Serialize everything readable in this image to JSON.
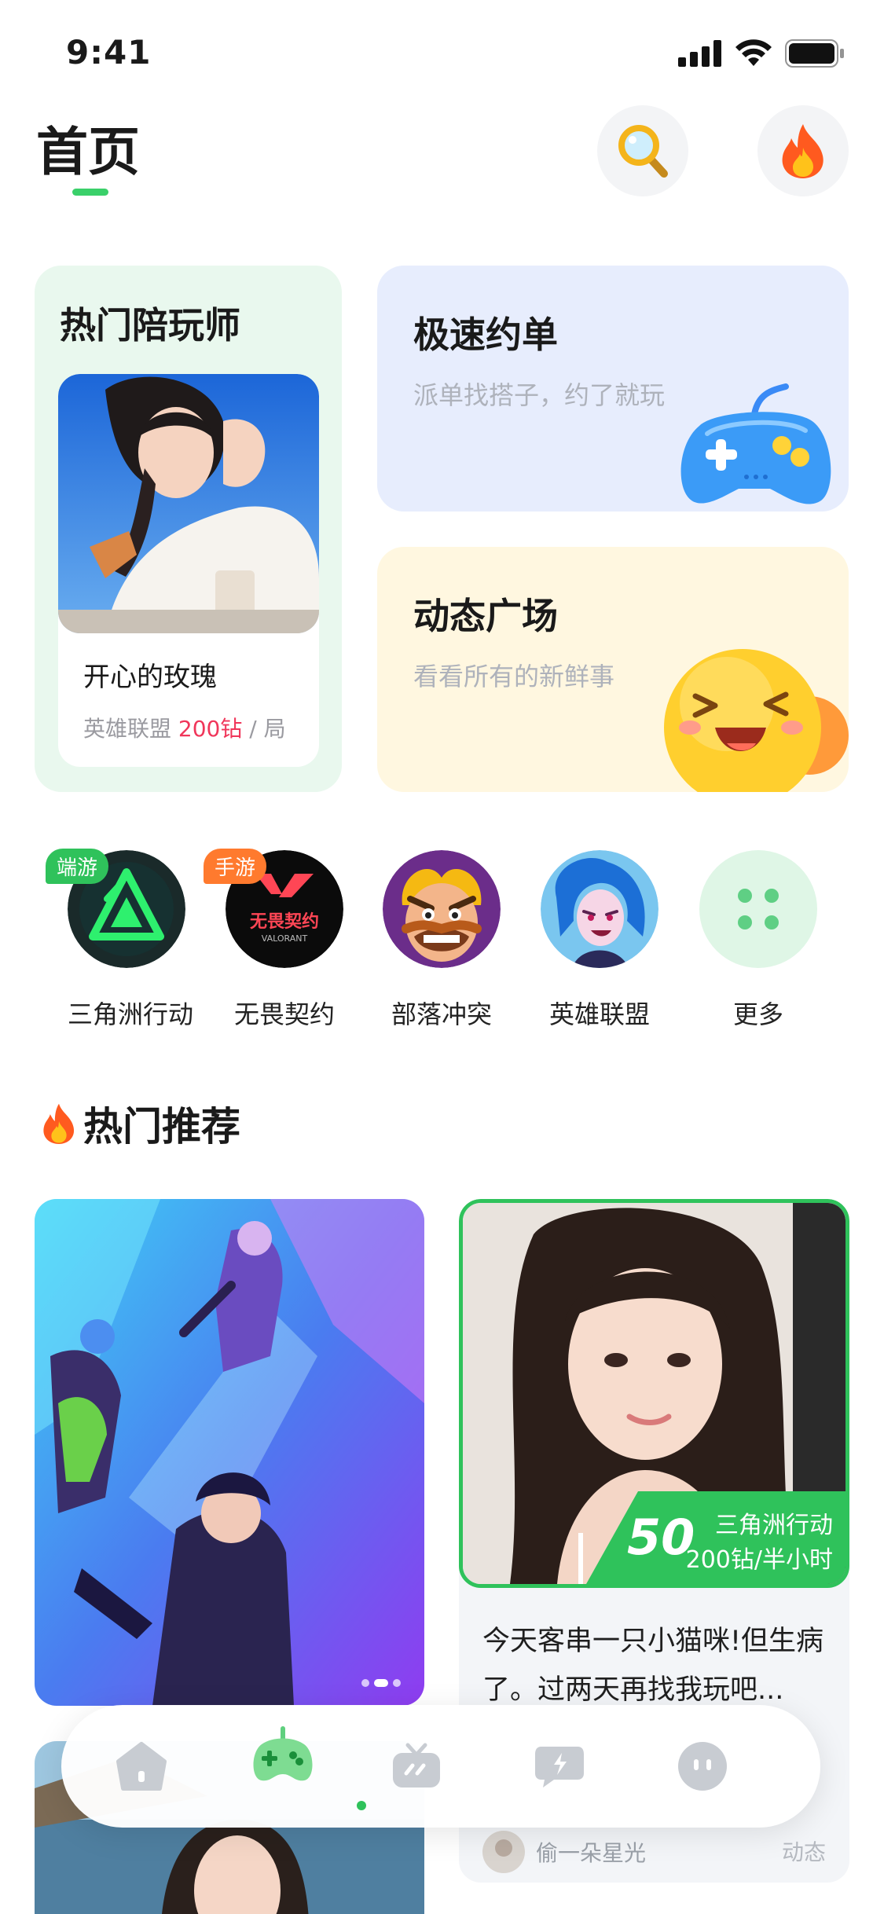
{
  "status_bar": {
    "time": "9:41"
  },
  "header": {
    "title": "首页",
    "search_icon": "search-icon",
    "hot_icon": "fire-icon"
  },
  "hot_companion": {
    "title": "热门陪玩师",
    "name": "开心的玫瑰",
    "game": "英雄联盟",
    "price": "200钻",
    "separator": "/",
    "unit": "局"
  },
  "fast_order": {
    "title": "极速约单",
    "subtitle": "派单找搭子，约了就玩",
    "icon": "gamepad-icon"
  },
  "feed_square": {
    "title": "动态广场",
    "subtitle": "看看所有的新鲜事",
    "icon": "laughing-emoji-icon"
  },
  "games": [
    {
      "label": "三角洲行动",
      "tag": "端游",
      "tag_color": "#2fc25b"
    },
    {
      "label": "无畏契约",
      "tag": "手游",
      "tag_color": "#ff7a2e",
      "logo_text": "无畏契约",
      "logo_sub": "VALORANT"
    },
    {
      "label": "部落冲突"
    },
    {
      "label": "英雄联盟"
    },
    {
      "label": "更多"
    }
  ],
  "section": {
    "title": "热门推荐",
    "icon": "fire-icon"
  },
  "recommend": {
    "price_number": "50",
    "game": "三角洲行动",
    "rate": "200钻/半小时",
    "text": "今天客串一只小猫咪!但生病了。过两天再找我玩吧...",
    "user": "偷一朵星光",
    "tag": "动态"
  },
  "tabbar": {
    "items": [
      "home-icon",
      "gamepad-icon",
      "tv-icon",
      "chat-flash-icon",
      "profile-icon"
    ],
    "active_index": 1
  },
  "colors": {
    "accent_green": "#2fc25b",
    "price_red": "#f0365a"
  }
}
